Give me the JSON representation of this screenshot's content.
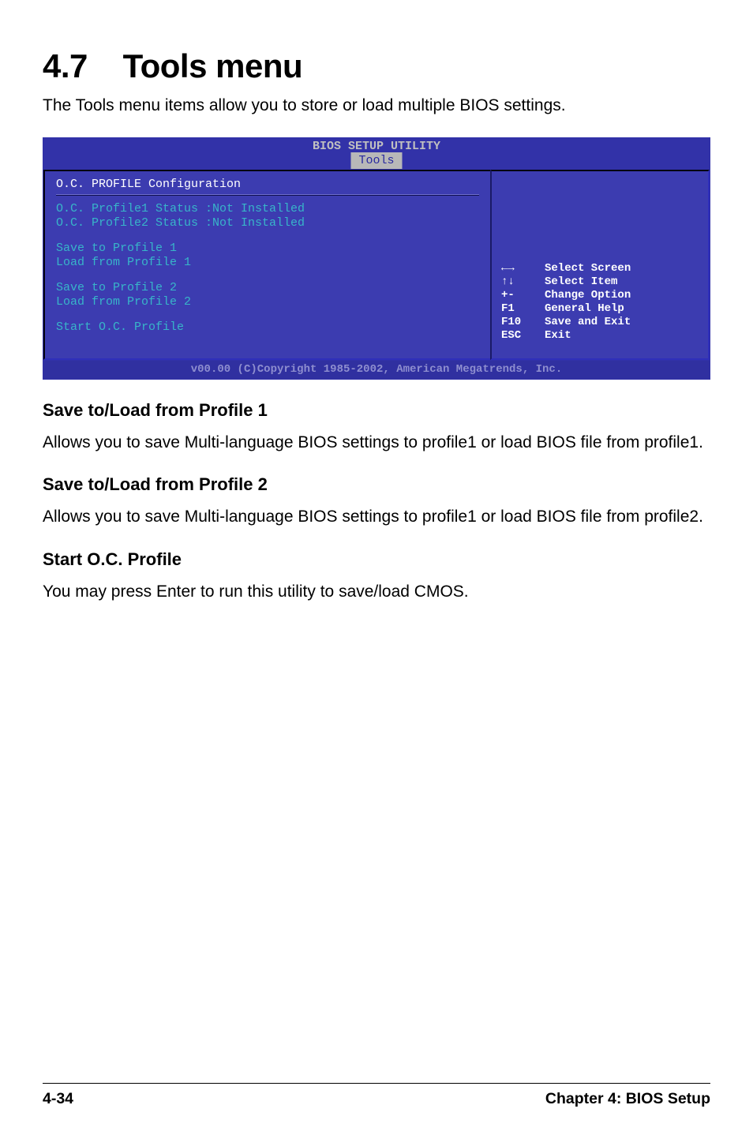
{
  "section_number": "4.7",
  "section_title": "Tools menu",
  "intro": "The Tools menu items allow you to store or load multiple BIOS settings.",
  "bios": {
    "header_title": "BIOS SETUP UTILITY",
    "tab": "Tools",
    "left": {
      "heading": "O.C. PROFILE Configuration",
      "status1": "O.C. Profile1 Status :Not Installed",
      "status2": "O.C. Profile2 Status :Not Installed",
      "save1": "Save to Profile 1",
      "load1": "Load from Profile 1",
      "save2": "Save to Profile 2",
      "load2": "Load from Profile 2",
      "start": "Start O.C. Profile"
    },
    "help": [
      {
        "key": "←→",
        "desc": "Select Screen"
      },
      {
        "key": "↑↓",
        "desc": "Select Item"
      },
      {
        "key": "+-",
        "desc": "Change Option"
      },
      {
        "key": "F1",
        "desc": "General Help"
      },
      {
        "key": "F10",
        "desc": "Save and Exit"
      },
      {
        "key": "ESC",
        "desc": "Exit"
      }
    ],
    "footer": "v00.00 (C)Copyright 1985-2002, American Megatrends, Inc."
  },
  "sub1": {
    "title": "Save to/Load from Profile 1",
    "text": "Allows you to save Multi-language BIOS settings to profile1 or load BIOS file from profile1."
  },
  "sub2": {
    "title": "Save to/Load from Profile 2",
    "text": "Allows you to save Multi-language BIOS settings to profile1 or load BIOS file from profile2."
  },
  "sub3": {
    "title": "Start O.C. Profile",
    "text": "You may press Enter to run this utility to save/load CMOS."
  },
  "page_footer": {
    "left": "4-34",
    "right": "Chapter 4: BIOS Setup"
  }
}
